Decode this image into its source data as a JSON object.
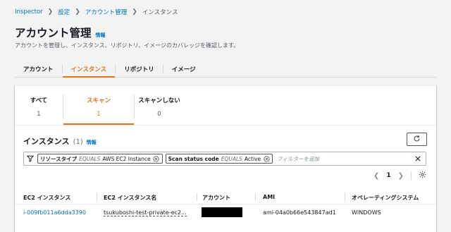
{
  "breadcrumb": {
    "items": [
      "Inspector",
      "設定",
      "アカウント管理"
    ],
    "current": "インスタンス"
  },
  "header": {
    "title": "アカウント管理",
    "info": "情報",
    "description": "アカウントを管理し、インスタンス、リポジトリ、イメージのカバレッジを確認します。"
  },
  "tabs": [
    "アカウント",
    "インスタンス",
    "リポジトリ",
    "イメージ"
  ],
  "counters": [
    {
      "label": "すべて",
      "value": "1"
    },
    {
      "label": "スキャン",
      "value": "1"
    },
    {
      "label": "スキャンしない",
      "value": "0"
    }
  ],
  "instances": {
    "title": "インスタンス",
    "count": "(1)",
    "info": "情報"
  },
  "filters": {
    "tokens": [
      {
        "key": "リソースタイプ",
        "op": "EQUALS",
        "value": "AWS EC2 Instance"
      },
      {
        "key": "Scan status code",
        "op": "EQUALS",
        "value": "Active"
      }
    ],
    "placeholder": "フィルターを追加"
  },
  "pagination": {
    "page": "1"
  },
  "table": {
    "columns": [
      "EC2 インスタンス",
      "EC2 インスタンス名",
      "アカウント",
      "AMI",
      "オペレーティングシステム"
    ],
    "rows": [
      {
        "instance_id": "i-009fb011a6dda3390",
        "instance_name": "tsukuboshi-test-private-ec2...",
        "account": "",
        "ami": "ami-04a0b66e543847ad1",
        "os": "WINDOWS"
      }
    ]
  },
  "colors": {
    "accent": "#ec7211",
    "link": "#0073bb",
    "background": "#f2f3f3"
  }
}
